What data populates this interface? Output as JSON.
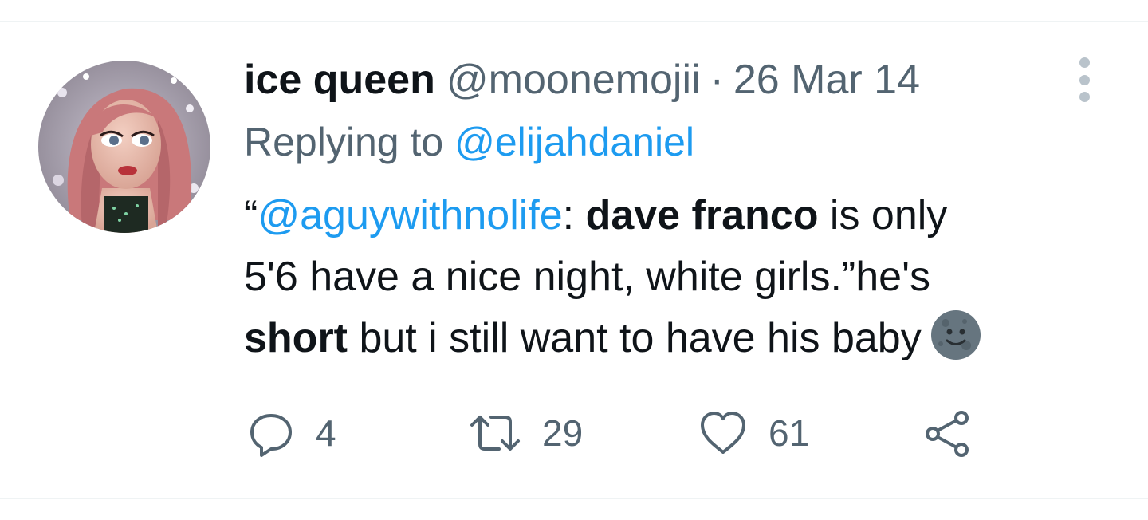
{
  "tweet": {
    "author_name": "ice queen",
    "author_handle": "@moonemojii",
    "separator": "·",
    "date": "26 Mar 14",
    "replying_prefix": "Replying to",
    "replying_to": "@elijahdaniel",
    "body": {
      "line1_quote_open": "“",
      "line1_mention": "@aguywithnolife",
      "line1_colon": ": ",
      "line1_bold": "dave franco",
      "line1_rest": " is only",
      "line2": "5'6 have a nice night, white girls.”he's",
      "line3_bold": "short",
      "line3_rest": " but i still want to have his baby"
    },
    "emoji_icon": "full-moon-face-icon",
    "actions": {
      "replies": "4",
      "retweets": "29",
      "likes": "61"
    }
  },
  "colors": {
    "primary_text": "#0f1419",
    "secondary_text": "#536471",
    "link": "#1d9bf0",
    "divider": "#eff3f4"
  }
}
